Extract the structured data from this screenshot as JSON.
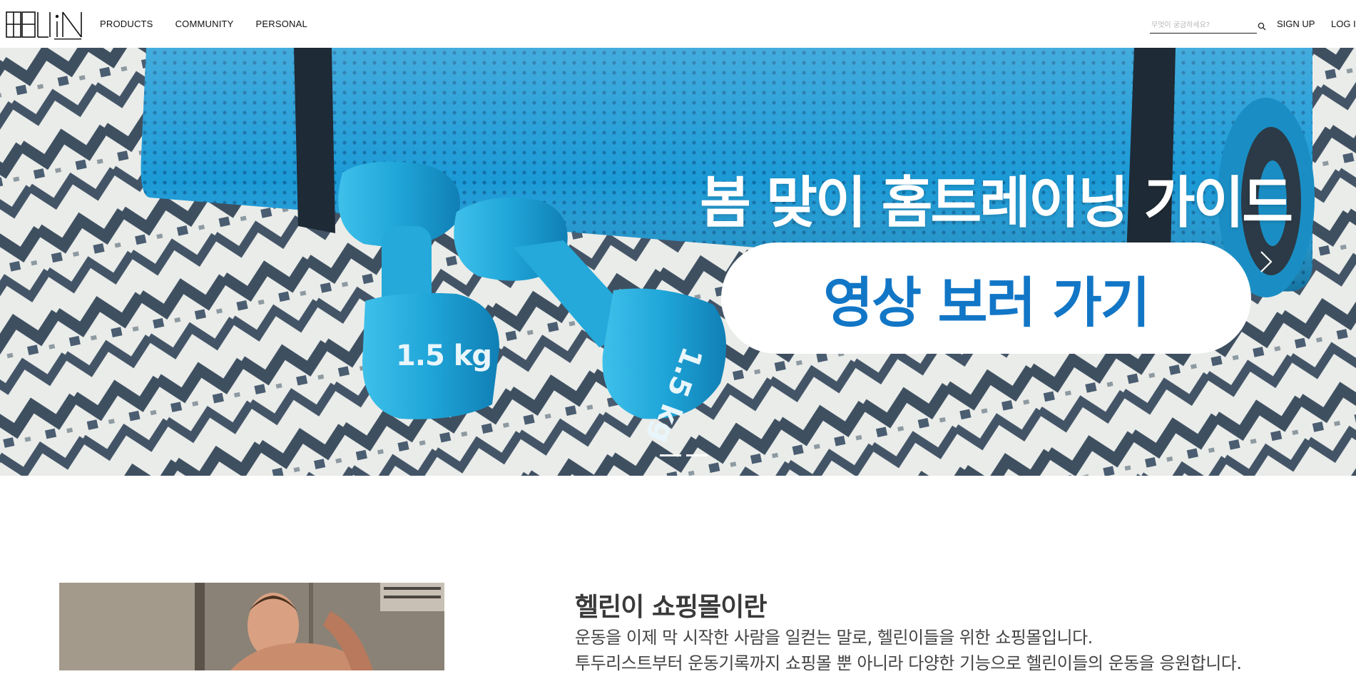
{
  "header": {
    "logo_text": "HELLIN",
    "nav": [
      "PRODUCTS",
      "COMMUNITY",
      "PERSONAL"
    ],
    "search_placeholder": "무엇이 궁금하세요?",
    "signup_label": "SIGN UP",
    "login_label": "LOG IN"
  },
  "hero": {
    "title": "봄 맞이 홈트레이닝 가이드",
    "cta_label": "영상 보러 가기",
    "dumbbell_label": "1.5 kg",
    "slide_count": 2,
    "active_slide": 1,
    "colors": {
      "mat": "#1a9ed9",
      "dumbbell": "#21a6d8",
      "cta_text": "#1276c6",
      "rug_dark": "#26384a"
    }
  },
  "about": {
    "title": "헬린이 쇼핑몰이란",
    "lines": [
      "운동을 이제 막 시작한 사람을 일컫는 말로, 헬린이들을 위한 쇼핑몰입니다.",
      "투두리스트부터 운동기록까지 쇼핑몰 뿐 아니라 다양한 기능으로 헬린이들의 운동을 응원합니다."
    ]
  },
  "icons": {
    "search": "search-icon",
    "next": "chevron-right-icon"
  }
}
